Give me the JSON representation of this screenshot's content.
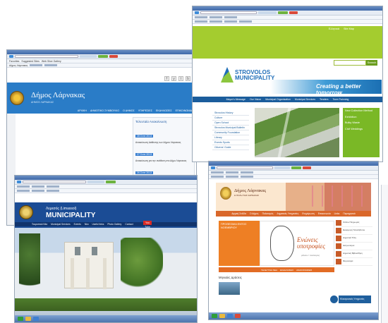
{
  "shots": {
    "larnaca_old": {
      "tab_title": "Δήμος Λάρνακας",
      "favorites": [
        "Favorites",
        "Suggested Sites",
        "Web Slice Gallery"
      ],
      "brand": "Δήμος Λάρνακας",
      "brand_sub": "ΔΗΜΟΣ ΛΑΡΝΑΚΑΣ",
      "nav": [
        "ΑΡΧΙΚΗ",
        "ΔΗΜΟΤΙΚΟ ΣΥΜΒΟΥΛΙΟ",
        "Ο ΔΗΜΟΣ",
        "ΥΠΗΡΕΣΙΕΣ",
        "ΕΚΔΗΛΩΣΕΙΣ",
        "ΕΠΙΚΟΙΝΩΝΙΑ"
      ],
      "socials": [
        "f",
        "y",
        "t",
        "b"
      ],
      "news_title": "Τελευταία Ανακοίνωση",
      "news": [
        {
          "date": "28 Σεπτ 2013",
          "text": "Ανακοίνωση Διάθεσης των Δήμου Λάρνακας"
        },
        {
          "date": "27 Σεπτ 2013",
          "text": "Ανακοίνωση για την ανάθεση στο Δήμο Λάρνακας"
        },
        {
          "date": "26 Σεπτ 2013",
          "text": "Νέα Ανακοίνωση Ιανουάριος 2013"
        }
      ]
    },
    "strovolos": {
      "green_links": [
        "Ελληνικά",
        "Site Map"
      ],
      "search_button": "Search",
      "logo_line1": "STROVOLOS",
      "logo_line2": "MUNICIPALITY",
      "tagline": "Creating a better tomorrow",
      "nav": [
        "Mayor's Message",
        "Our Vision",
        "Municipal Organisation",
        "Municipal Services",
        "Tenders",
        "Town Twinning"
      ],
      "side_menu": [
        "Strovolos History",
        "Culture",
        "Open School",
        "Strovolos Municipal Bulletin",
        "Community Foundation",
        "Library",
        "Events Sports",
        "Citizens' Guide"
      ],
      "green_box": [
        "New Collection Method",
        "Exhibition",
        "Bulky Waste",
        "Civil Weddings"
      ]
    },
    "limassol": {
      "name_line1": "Λεμεσός (Limassol)",
      "name_line2": "MUNICIPALITY",
      "nav": [
        "Τουριστικά Νέα",
        "Municipal Services",
        "Events",
        "Νέα",
        "Useful links",
        "Photo Gallery",
        "Contact"
      ],
      "yt": "You Tube"
    },
    "larnaca_new": {
      "brand": "Δήμος Λάρνακας",
      "brand_sub": "Η ΠΟΛΗ ΤΗΣ ΛΑΡΝΑΚΑΣ",
      "nav": [
        "Αρχική Σελίδα",
        "Ο Δήμος",
        "Πολιτισμός",
        "Δημοτικές Υπηρεσίες",
        "Ενημέρωση",
        "Επικοινωνία",
        "Links",
        "Περιηγητικά"
      ],
      "orange_title": "ΠΡΟΘΕΣΜΙΑ ΕΝΤΟΣ ΝΟΕΜΒΡΙΟΥ",
      "feature_title_1": "Ενώνεις",
      "feature_title_2": "υποτροφίες",
      "feature_sub": "μέλλον / πολιτισμός",
      "tabs": [
        "ΤΕΛΕΥΤΑΙΑ ΝΕΑ",
        "ΕΚΔΗΛΩΣΕΙΣ",
        "ΑΝΑΚΟΙΝΩΣΕΙΣ"
      ],
      "right_items": [
        "Online Πληρωμές",
        "Εφαρμογή Smartphone",
        "Δημοτικά Τέλη",
        "Διαγωνισμοί",
        "Δημοτική Βιβλιοθήκη",
        "Φορολογία"
      ],
      "news_heading": "Μηνιαίες Δράσεις",
      "blue_item": "Ηλεκτρονικές Υπηρεσίες"
    }
  },
  "colors": {
    "larnaca_blue": "#2a7cc7",
    "strovolos_green": "#a4cc2f",
    "limassol_navy": "#1b4c95",
    "larnaca_orange": "#ee7f24"
  }
}
